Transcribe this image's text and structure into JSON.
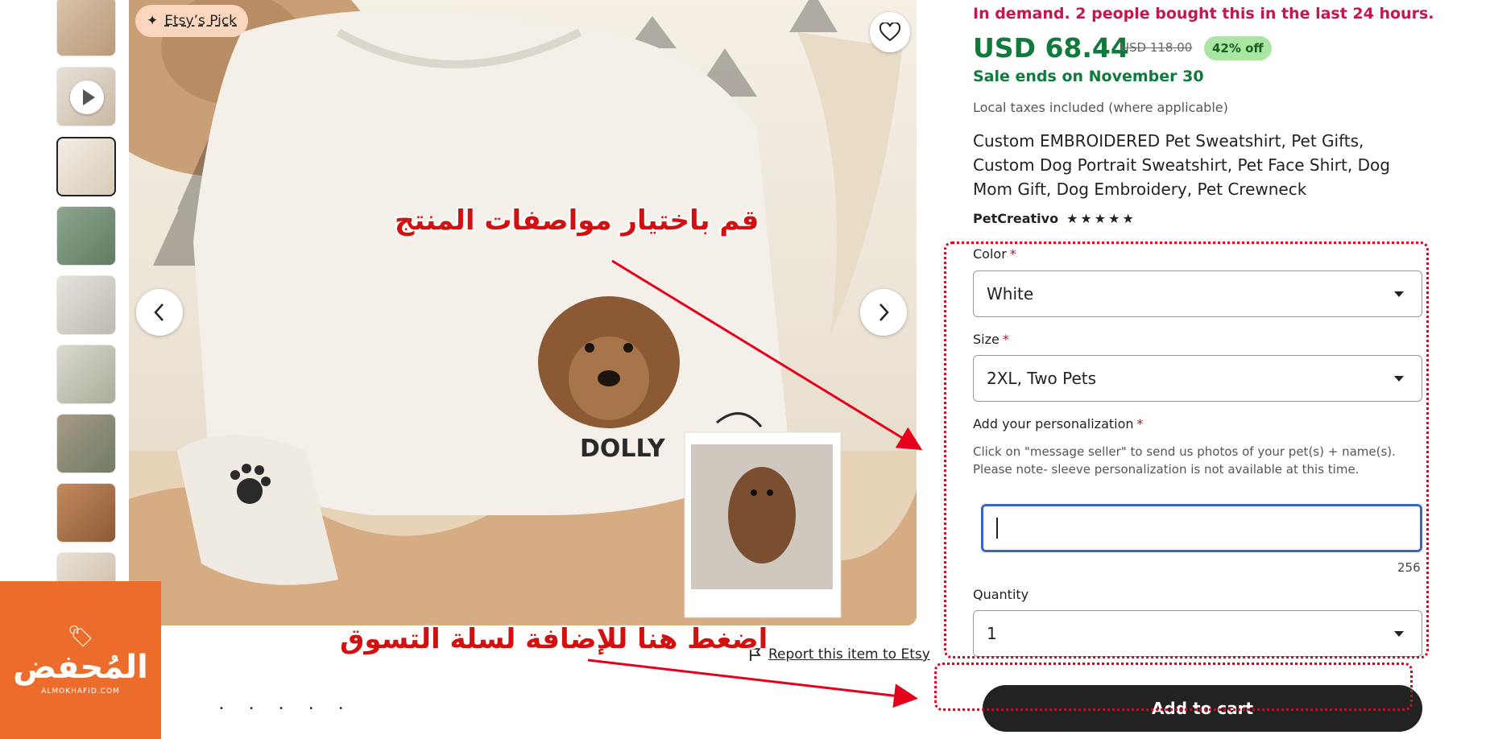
{
  "listing": {
    "badge": "Etsy’s Pick",
    "demand": "In demand. 2 people bought this in the last 24 hours.",
    "price": "USD 68.44",
    "original_price": "USD 118.00",
    "discount": "42% off",
    "sale_ends": "Sale ends on November 30",
    "taxes": "Local taxes included (where applicable)",
    "title": "Custom EMBROIDERED Pet Sweatshirt, Pet Gifts, Custom Dog Portrait Sweatshirt, Pet Face Shirt, Dog Mom Gift, Dog Embroidery, Pet Crewneck",
    "shop": "PetCreativo",
    "stars": "★★★★★",
    "report": "Report this item to Etsy",
    "rating_dots": "• • • • •"
  },
  "form": {
    "color_label": "Color",
    "color_value": "White",
    "size_label": "Size",
    "size_value": "2XL, Two Pets",
    "personalization_label": "Add your personalization",
    "personalization_help": "Click on \"message seller\" to send us photos of your pet(s) + name(s). Please note- sleeve personalization is not available at this time.",
    "char_count": "256",
    "quantity_label": "Quantity",
    "quantity_value": "1",
    "required_mark": "*",
    "add_to_cart": "Add to cart"
  },
  "image": {
    "pet_name": "DOLLY"
  },
  "annotations": {
    "choose_specs": "قم باختيار مواصفات المنتج",
    "add_to_cart_hint": "اضغط هنا للإضافة لسلة التسوق"
  },
  "logo": {
    "name": "المُحفض",
    "domain": "ALMOKHAFID.COM"
  },
  "colors": {
    "price_green": "#0f7a3a",
    "demand_red": "#c4174c",
    "annotation_red": "#d21010",
    "logo_orange": "#ec6d2b",
    "focus_blue": "#3b66c4"
  }
}
